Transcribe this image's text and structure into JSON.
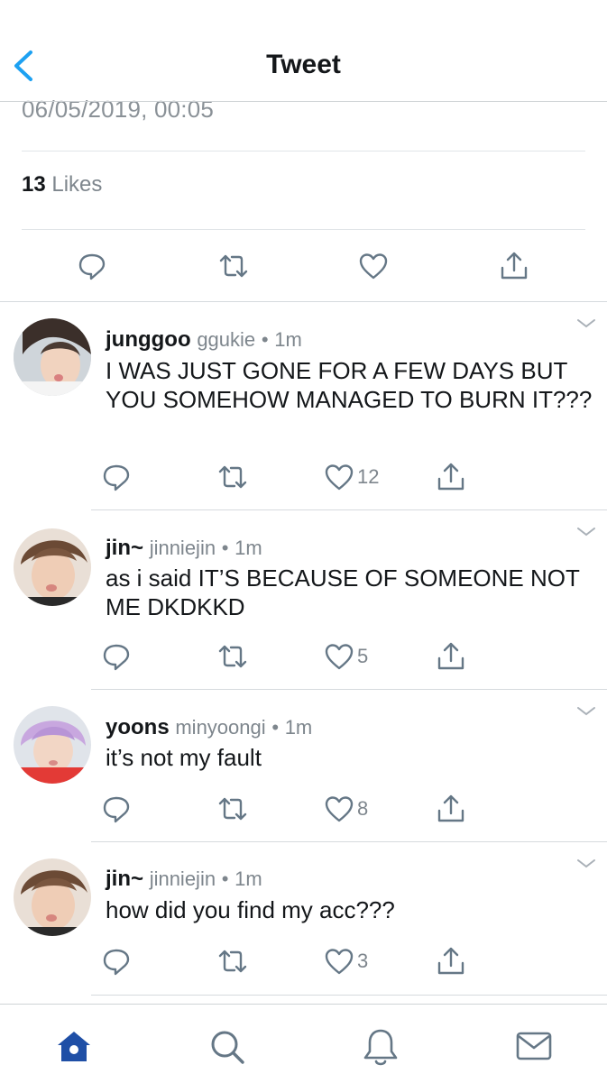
{
  "header": {
    "title": "Tweet",
    "back_icon": "chevron-left-icon"
  },
  "main_tweet": {
    "timestamp": "06/05/2019, 00:05",
    "likes_count": "13",
    "likes_label": "Likes",
    "actions": [
      "reply-icon",
      "retweet-icon",
      "heart-icon",
      "share-icon"
    ]
  },
  "replies": [
    {
      "name": "junggoo",
      "handle": "ggukie",
      "dot": "•",
      "time": "1m",
      "text": "I WAS JUST GONE FOR A FEW DAYS BUT YOU SOMEHOW MANAGED TO BURN IT???",
      "like_count": "12",
      "avatar_color": "#cdd3d8"
    },
    {
      "name": "jin~",
      "handle": "jinniejin",
      "dot": "•",
      "time": "1m",
      "text": "as i said IT’S BECAUSE OF SOMEONE NOT ME DKDKKD",
      "like_count": "5",
      "avatar_color": "#e7d7cb"
    },
    {
      "name": "yoons",
      "handle": "minyoongi",
      "dot": "•",
      "time": "1m",
      "text": "it’s not my fault",
      "like_count": "8",
      "avatar_color": "#e8524f"
    },
    {
      "name": "jin~",
      "handle": "jinniejin",
      "dot": "•",
      "time": "1m",
      "text": "how did you find my acc???",
      "like_count": "3",
      "avatar_color": "#e7d7cb"
    }
  ],
  "tabbar": {
    "items": [
      "home-icon",
      "search-icon",
      "notifications-icon",
      "messages-icon"
    ],
    "active_color": "#1f4fa6"
  },
  "colors": {
    "accent": "#1da1f2",
    "icon_gray": "#657786",
    "text_secondary": "#7e868d"
  }
}
